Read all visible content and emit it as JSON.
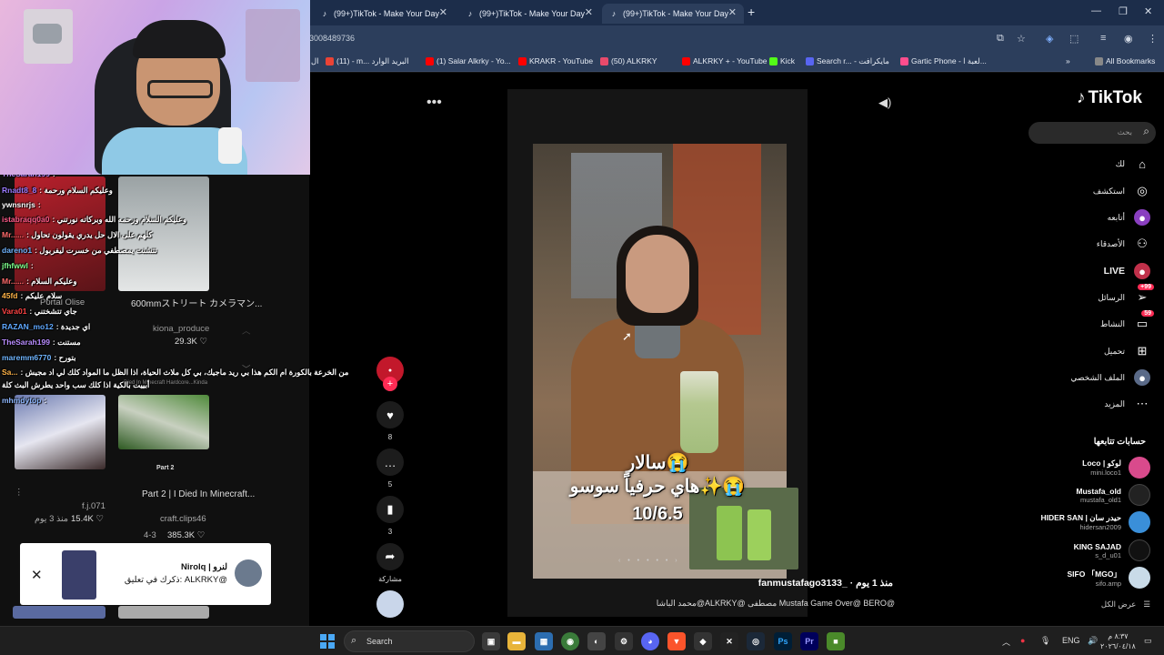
{
  "browser": {
    "tabs": [
      {
        "title": "(99+)TikTok - Make Your Day"
      },
      {
        "title": "(99+)TikTok - Make Your Day"
      },
      {
        "title": "(99+)TikTok - Make Your Day"
      }
    ],
    "url": "3008489736",
    "bookmarks": [
      {
        "label": "(11) - m... البريد الوارد",
        "color": "#ea4335"
      },
      {
        "label": "(1) Salar Alkrky - Yo...",
        "color": "#ff0000"
      },
      {
        "label": "KRAKR - YouTube",
        "color": "#ff0000"
      },
      {
        "label": "(50) ALKRKY",
        "color": "#e84a6b"
      },
      {
        "label": "ALKRKY + - YouTube",
        "color": "#ff0000"
      },
      {
        "label": "Kick",
        "color": "#53fc18"
      },
      {
        "label": "Search r... - مايكرافت",
        "color": "#5865f2"
      },
      {
        "label": "Gartic Phone - لعبة ا...",
        "color": "#ff4d8d"
      }
    ],
    "all_bookmarks": "All Bookmarks",
    "bookmark_lead": "ال"
  },
  "chat": [
    {
      "user": "TheSarah199",
      "msg": ":",
      "color": "#b88cff"
    },
    {
      "user": "Rnadt8_8",
      "msg": ": وعليكم السلام ورحمة",
      "color": "#9b7bff"
    },
    {
      "user": "ywnsnrjs",
      "msg": ":",
      "color": "#ffffff"
    },
    {
      "user": "istabraqq0a0",
      "msg": ": وعليكم السلام ورحمه الله وبركاته نورتني",
      "color": "#ff5c8a"
    },
    {
      "user": "Mr......",
      "msg": ": كلهم على الال حل يدري يقولون تحاول",
      "color": "#ff6b6b"
    },
    {
      "user": "dareno1",
      "msg": ": تتشنت يمصطفي من خسرت ليفربول",
      "color": "#6fb5ff"
    },
    {
      "user": "jfhfwwl",
      "msg": ":",
      "color": "#7dff8c"
    },
    {
      "user": "Mr......",
      "msg": ": وعليكم السلام",
      "color": "#ff6b6b"
    },
    {
      "user": "45fd",
      "msg": ": سلام عليكم",
      "color": "#ffb347"
    },
    {
      "user": "Vara01",
      "msg": ": جاي تتشختني",
      "color": "#ff4444"
    },
    {
      "user": "RAZAN_mo12",
      "msg": ": اي جديدة",
      "color": "#5fa8ff"
    },
    {
      "user": "TheSarah199",
      "msg": ": مستنت",
      "color": "#b88cff"
    },
    {
      "user": "maremm6770",
      "msg": ": بتورح",
      "color": "#6fb5ff"
    },
    {
      "user": "Sa...",
      "msg": ": من الخرعة بالكورة ام الكم هذا بي ريد ماجيك، بي كل ملاث الحياة، اذا الظل ما المواد كلك لي اد مجيش",
      "color": "#ffb347"
    },
    {
      "user": "",
      "msg": "أبييت بالكية اذا كلك سب واحد يطرش البث كلة",
      "color": "#ffffff"
    },
    {
      "user": "mhmdytop",
      "msg": ":",
      "color": "#8fb8ff"
    }
  ],
  "left_videos": [
    {
      "title": "600mmストリート カメラマン...",
      "author": "kiona_produce",
      "views": "29.3K"
    },
    {
      "title": "Part 2 | I Died In Minecraft...",
      "author": "craft.clips46",
      "date": "4-3",
      "views": "385.3K",
      "caption": "Part 2"
    },
    {
      "author": "f.j.071",
      "views": "15.4K",
      "date": "منذ 3 يوم"
    }
  ],
  "left_misc": {
    "portal": "Portal Olise",
    "minecraft_caption": "Died In Minecraft Hardcore...Kinda"
  },
  "notification": {
    "name": "Nirolq | لنرو",
    "text": "ذكرك في تعليق: ALKRKY@"
  },
  "feed": {
    "likes": "8",
    "comments": "5",
    "saves": "3",
    "share_label": "مشاركة",
    "overlay_line1": "سالار😭",
    "overlay_line2": "هاي حرفياً سوسو✨😭",
    "overlay_line3": "10/6.5",
    "author": "fanmustafago3133_ · منذ 1 يوم",
    "caption": "محمد الباشا@ALKRKY@ مصطفى Mustafa Game Over@ BERO@",
    "carousel": "‹ • • • • • ›"
  },
  "sidebar": {
    "logo": "TikTok",
    "search_placeholder": "بحث",
    "nav": [
      {
        "label": "لك",
        "icon": "home-icon"
      },
      {
        "label": "استكشف",
        "icon": "compass-icon"
      },
      {
        "label": "أتابعه",
        "icon": "following-icon"
      },
      {
        "label": "الأصدقاء",
        "icon": "friends-icon"
      },
      {
        "label": "LIVE",
        "icon": "live-icon"
      },
      {
        "label": "الرسائل",
        "icon": "messages-icon",
        "badge": "+99"
      },
      {
        "label": "النشاط",
        "icon": "activity-icon",
        "badge": "59"
      },
      {
        "label": "تحميل",
        "icon": "upload-icon"
      },
      {
        "label": "الملف الشخصي",
        "icon": "profile-icon"
      },
      {
        "label": "المزيد",
        "icon": "more-icon"
      }
    ],
    "following_title": "حسابات تتابعها",
    "following": [
      {
        "name": "Loco | لوكو",
        "handle": "mini.loco1",
        "color": "#d94a8c"
      },
      {
        "name": "Mustafa_old",
        "handle": "mustafa_old1",
        "color": "#222222"
      },
      {
        "name": "HIDER SAN | حيدر سان",
        "handle": "hidersan2009",
        "color": "#3a8fd9"
      },
      {
        "name": "KING SAJAD",
        "handle": "s_d_u01",
        "color": "#111111"
      },
      {
        "name": "SIFO 「MGO」",
        "handle": "sifo.amp",
        "color": "#c9dbe8"
      }
    ],
    "see_all": "عرض الكل"
  },
  "taskbar": {
    "search": "Search",
    "lang": "ENG",
    "time": "٨:٣٧ م",
    "date": "٢٠٢٦/٠٤/١٨"
  }
}
